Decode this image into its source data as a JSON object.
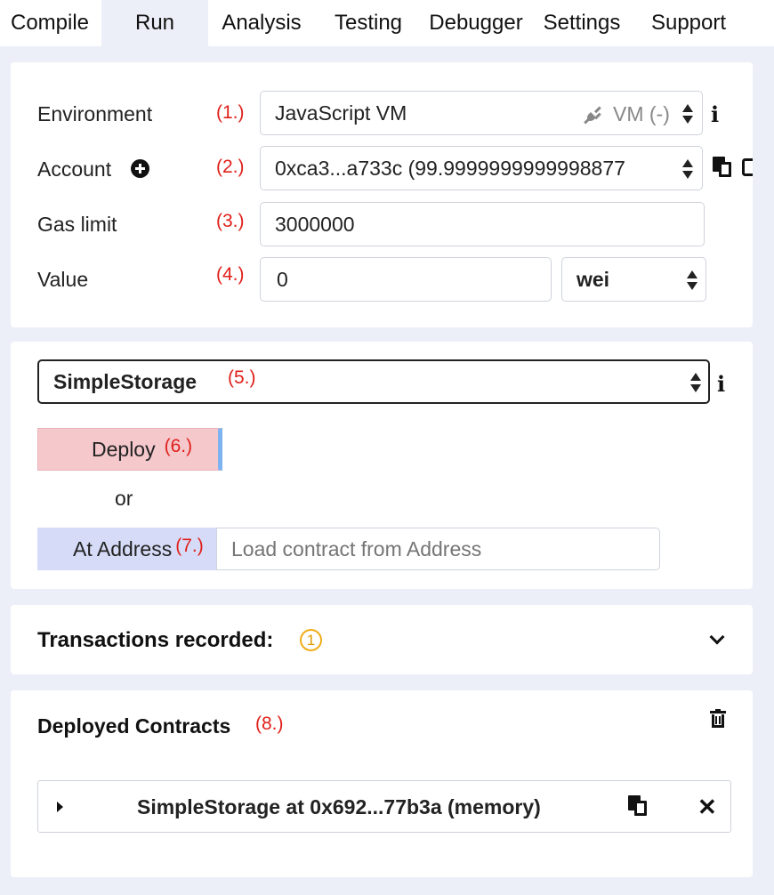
{
  "tabs": [
    {
      "label": "Compile"
    },
    {
      "label": "Run"
    },
    {
      "label": "Analysis"
    },
    {
      "label": "Testing"
    },
    {
      "label": "Debugger"
    },
    {
      "label": "Settings"
    },
    {
      "label": "Support"
    }
  ],
  "settings": {
    "environment": {
      "label": "Environment",
      "marker": "(1.)",
      "value": "JavaScript VM",
      "badge": "VM (-)"
    },
    "account": {
      "label": "Account",
      "marker": "(2.)",
      "value": "0xca3...a733c (99.9999999999998877"
    },
    "gas_limit": {
      "label": "Gas limit",
      "marker": "(3.)",
      "value": "3000000"
    },
    "value": {
      "label": "Value",
      "marker": "(4.)",
      "value": "0",
      "unit": "wei"
    }
  },
  "contract": {
    "selected": "SimpleStorage",
    "marker": "(5.)",
    "deploy_label": "Deploy",
    "deploy_marker": "(6.)",
    "or_text": "or",
    "at_address_label": "At Address",
    "at_address_marker": "(7.)",
    "address_placeholder": "Load contract from Address"
  },
  "transactions": {
    "label": "Transactions recorded:",
    "count": "1"
  },
  "deployed": {
    "title": "Deployed Contracts",
    "marker": "(8.)",
    "instance_label": "SimpleStorage at 0x692...77b3a (memory)"
  },
  "colors": {
    "deploy_bg": "#f5c8cc",
    "at_address_bg": "#d6dbf7",
    "marker_red": "#e0201a",
    "badge_orange": "#f0ad1a",
    "page_bg": "#edeff8"
  },
  "icons": [
    "plug-icon",
    "info-icon",
    "plus-circle-icon",
    "copy-icon",
    "chevron-down-icon",
    "trash-icon",
    "caret-right-icon",
    "close-icon"
  ]
}
